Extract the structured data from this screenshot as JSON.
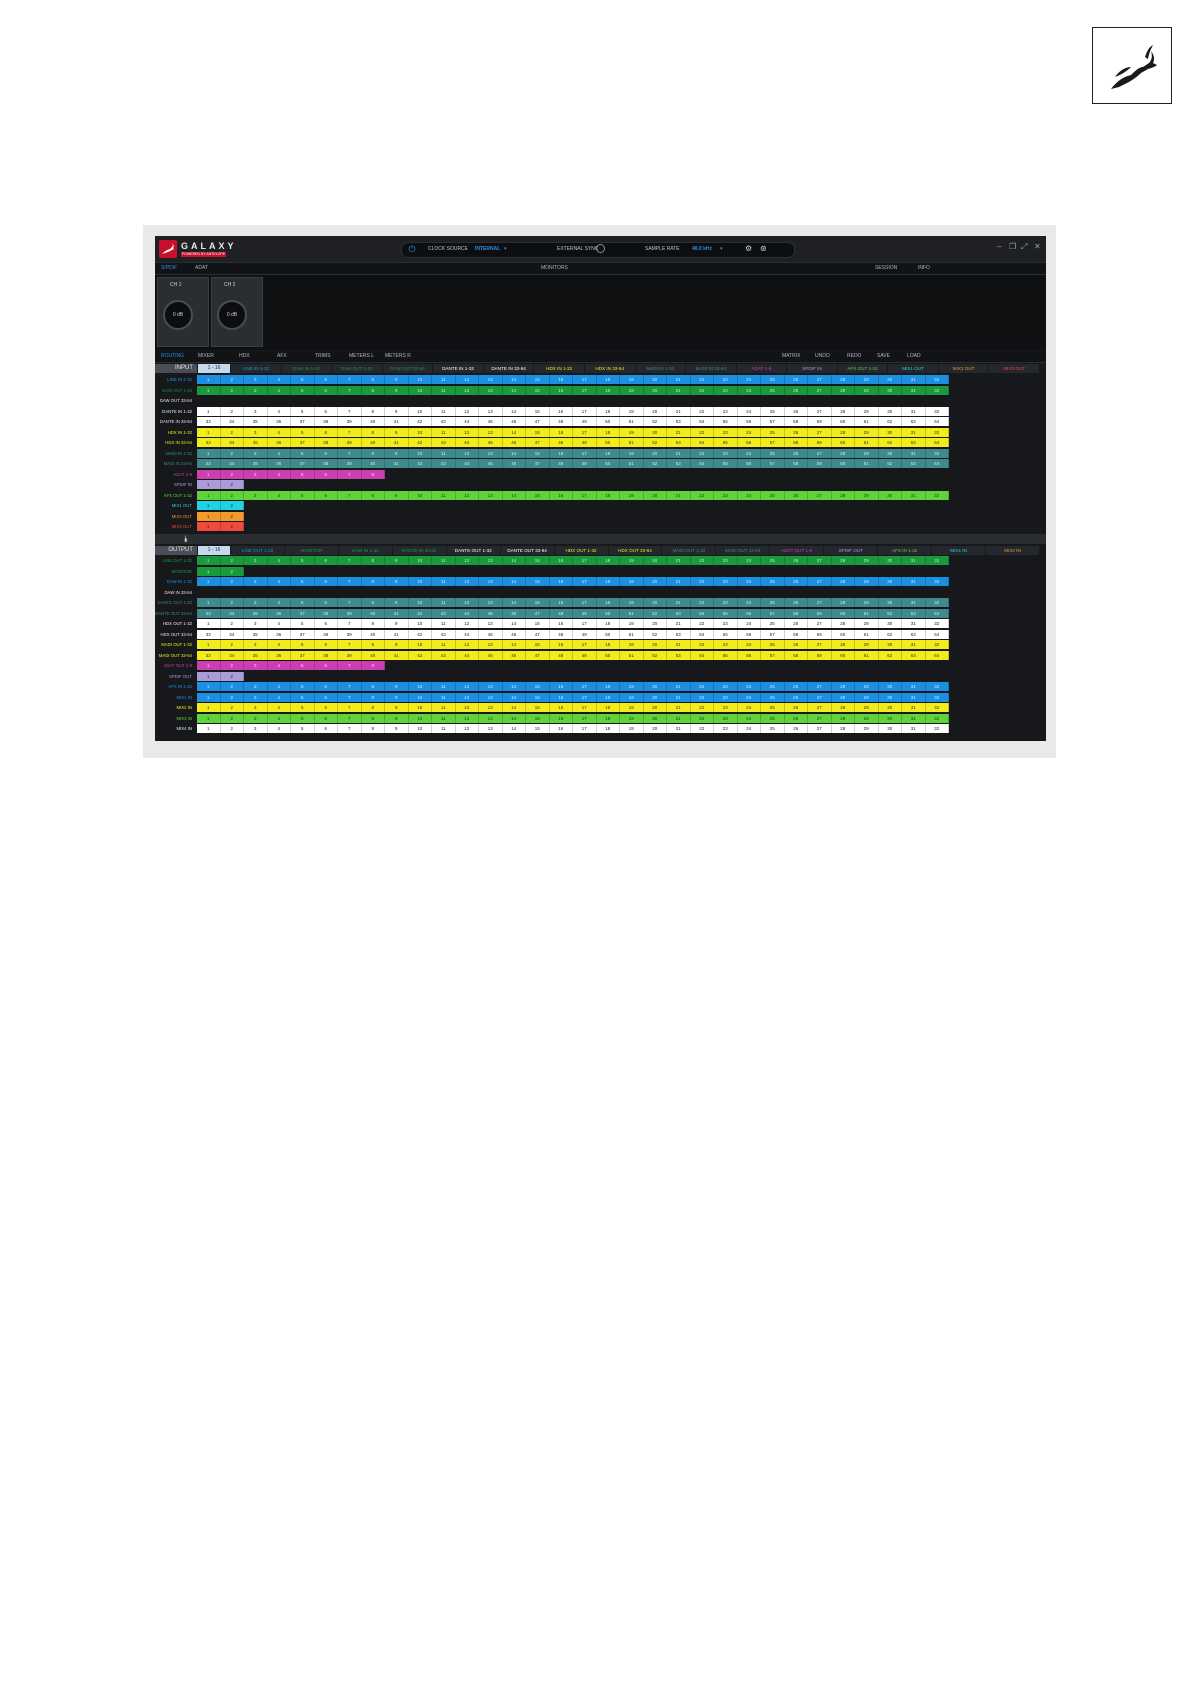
{
  "titlebar": {
    "brand": "GALAXY",
    "brand_sub": "POWERED BY ANTELOPE",
    "clock_source_label": "CLOCK SOURCE",
    "clock_source_value": "INTERNAL",
    "external_sync_label": "EXTERNAL SYNC",
    "sample_rate_label": "SAMPLE RATE",
    "sample_rate_value": "48.0 kHz"
  },
  "tabs": [
    "S/PDIF",
    "ADAT",
    "MONITORS",
    "SESSION",
    "INFO"
  ],
  "strips": [
    {
      "label": "CH 1",
      "value": "0 dB"
    },
    {
      "label": "CH 2",
      "value": "0 dB"
    }
  ],
  "section_nav": {
    "left": [
      "ROUTING",
      "MIXER",
      "HDX",
      "AFX",
      "TRIMS",
      "METERS L",
      "METERS R"
    ],
    "right": [
      "MATRIX",
      "UNDO",
      "REDO",
      "SAVE",
      "LOAD"
    ]
  },
  "input": {
    "title": "INPUT",
    "selector": "1 - 16",
    "sources": [
      "LINE IN 1-32",
      "DAW IN 1-32",
      "DAW OUT 1-32",
      "DAW OUT 33-64",
      "DANTE IN 1-32",
      "DANTE IN 33-64",
      "HDX IN 1-32",
      "HDX IN 33-64",
      "MADI IN 1-32",
      "MADI IN 33-64",
      "ADAT 1-8",
      "SPDIF IN",
      "AFX OUT 1-32",
      "MIX1 OUT",
      "MIX2 OUT",
      "MIX3 OUT"
    ],
    "rows": [
      {
        "label": "LINE IN 1-32",
        "color": "#1c8fe0",
        "text": "#dbe9f7",
        "start": 1,
        "count": 32
      },
      {
        "label": "DAW OUT 1-32",
        "color": "#1a9a3c",
        "text": "#cfe9d4",
        "start": 1,
        "count": 32
      },
      {
        "label": "DAW OUT 33-64",
        "color": "",
        "text": "",
        "start": 0,
        "count": 0
      },
      {
        "label": "DANTE IN 1-32",
        "color": "#ffffff",
        "text": "#222222",
        "start": 1,
        "count": 32
      },
      {
        "label": "DANTE IN 33-64",
        "color": "#ffffff",
        "text": "#222222",
        "start": 33,
        "count": 32
      },
      {
        "label": "HDX IN 1-32",
        "color": "#f2ec1a",
        "text": "#333333",
        "start": 1,
        "count": 32
      },
      {
        "label": "HDX IN 33-64",
        "color": "#f2ec1a",
        "text": "#333333",
        "start": 33,
        "count": 32
      },
      {
        "label": "MADI IN 1-32",
        "color": "#3f8a8c",
        "text": "#d8ecec",
        "start": 1,
        "count": 32
      },
      {
        "label": "MADI IN 33-64",
        "color": "#3f8a8c",
        "text": "#d8ecec",
        "start": 33,
        "count": 32
      },
      {
        "label": "ADAT 1-8",
        "color": "#cc3fb0",
        "text": "#f6d9ef",
        "start": 1,
        "count": 8
      },
      {
        "label": "SPDIF IN",
        "color": "#a99cd8",
        "text": "#2a2340",
        "start": 1,
        "count": 2
      },
      {
        "label": "AFX OUT 1-32",
        "color": "#5fd33a",
        "text": "#173d0d",
        "start": 1,
        "count": 32
      },
      {
        "label": "MIX1 OUT",
        "color": "#1fd3e0",
        "text": "#083338",
        "start": 1,
        "count": 2
      },
      {
        "label": "MIX2 OUT",
        "color": "#f39a2b",
        "text": "#3b2106",
        "start": 1,
        "count": 2
      },
      {
        "label": "MIX3 OUT",
        "color": "#ef4a3e",
        "text": "#3b0c09",
        "start": 1,
        "count": 2
      }
    ]
  },
  "output": {
    "title": "OUTPUT",
    "selector": "1 - 16",
    "sources": [
      "LINE OUT 1-32",
      "MONITOR",
      "DAW IN 1-32",
      "DANTE IN 33-64",
      "DANTE OUT 1-32",
      "DANTE OUT 33-64",
      "HDX OUT 1-32",
      "HDX OUT 33-64",
      "MADI OUT 1-32",
      "MADI OUT 33-64",
      "ADAT OUT 1-8",
      "SPDIF OUT",
      "AFX IN 1-32",
      "MIX1 IN",
      "MIX2 IN"
    ],
    "rows": [
      {
        "label": "LINE OUT 1-32",
        "color": "#1a9a3c",
        "text": "#cfe9d4",
        "start": 1,
        "count": 32
      },
      {
        "label": "MONITOR",
        "color": "#1a9a3c",
        "text": "#cfe9d4",
        "start": 1,
        "count": 2
      },
      {
        "label": "DAW IN 1-32",
        "color": "#1c8fe0",
        "text": "#dbe9f7",
        "start": 1,
        "count": 32
      },
      {
        "label": "DAW IN 33-64",
        "color": "",
        "text": "",
        "start": 0,
        "count": 0
      },
      {
        "label": "DANTE OUT 1-32",
        "color": "#3f8a8c",
        "text": "#d8ecec",
        "start": 1,
        "count": 32
      },
      {
        "label": "DANTE OUT 33-64",
        "color": "#3f8a8c",
        "text": "#d8ecec",
        "start": 33,
        "count": 32
      },
      {
        "label": "HDX OUT 1-32",
        "color": "#ffffff",
        "text": "#222222",
        "start": 1,
        "count": 32
      },
      {
        "label": "HDX OUT 33-64",
        "color": "#ffffff",
        "text": "#222222",
        "start": 33,
        "count": 32
      },
      {
        "label": "MADI OUT 1-32",
        "color": "#f2ec1a",
        "text": "#333333",
        "start": 1,
        "count": 32
      },
      {
        "label": "MADI OUT 33-64",
        "color": "#f2ec1a",
        "text": "#333333",
        "start": 33,
        "count": 32
      },
      {
        "label": "ADAT OUT 1-8",
        "color": "#cc3fb0",
        "text": "#f6d9ef",
        "start": 1,
        "count": 8
      },
      {
        "label": "SPDIF OUT",
        "color": "#a99cd8",
        "text": "#2a2340",
        "start": 1,
        "count": 2
      },
      {
        "label": "AFX IN 1-32",
        "color": "#1c8fe0",
        "text": "#dbe9f7",
        "start": 1,
        "count": 32
      },
      {
        "label": "MIX1 IN",
        "color": "#1c8fe0",
        "text": "#dbe9f7",
        "start": 1,
        "count": 32
      },
      {
        "label": "MIX2 IN",
        "color": "#f2ec1a",
        "text": "#333333",
        "start": 1,
        "count": 32
      },
      {
        "label": "MIX3 IN",
        "color": "#5fd33a",
        "text": "#173d0d",
        "start": 1,
        "count": 32
      },
      {
        "label": "MIX4 IN",
        "color": "#ffffff",
        "text": "#222222",
        "start": 1,
        "count": 32
      }
    ]
  },
  "colors": {
    "accent": "#1c8fe0",
    "brand": "#c8102e"
  }
}
